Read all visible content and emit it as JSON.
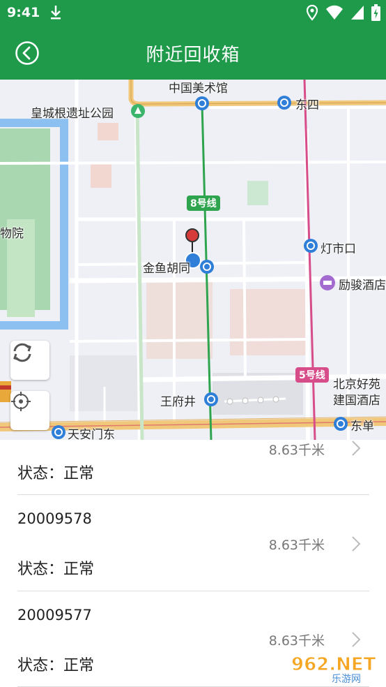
{
  "status_bar": {
    "time": "9:41"
  },
  "app_bar": {
    "title": "附近回收箱"
  },
  "map": {
    "labels": {
      "art_museum": "中国美术馆",
      "dongsi": "东四",
      "ruins_park": "皇城根遗址公园",
      "line8": "8号线",
      "museum": "物院",
      "dengshikou": "灯市口",
      "jinyuhutong": "金鱼胡同",
      "hotel": "励骏酒店",
      "line5": "5号线",
      "hotel_bj_1": "北京好苑",
      "hotel_bj_2": "建国酒店",
      "wangfujing": "王府井",
      "tiananmen_east": "天安门东",
      "dongdan": "东单"
    }
  },
  "list": {
    "items": [
      {
        "id": "",
        "distance": "8.63千米",
        "status": "状态：正常"
      },
      {
        "id": "20009578",
        "distance": "8.63千米",
        "status": "状态：正常"
      },
      {
        "id": "20009577",
        "distance": "8.63千米",
        "status": "状态：正常"
      }
    ]
  },
  "watermark": {
    "text": "962.NET",
    "sub": "乐游网"
  },
  "colors": {
    "brand_green": "#1e9a4a",
    "line8_green": "#2ea44f",
    "line5_pink": "#d64d8a",
    "metro_blue": "#2f7ed8",
    "marker_red": "#d63a3a"
  }
}
